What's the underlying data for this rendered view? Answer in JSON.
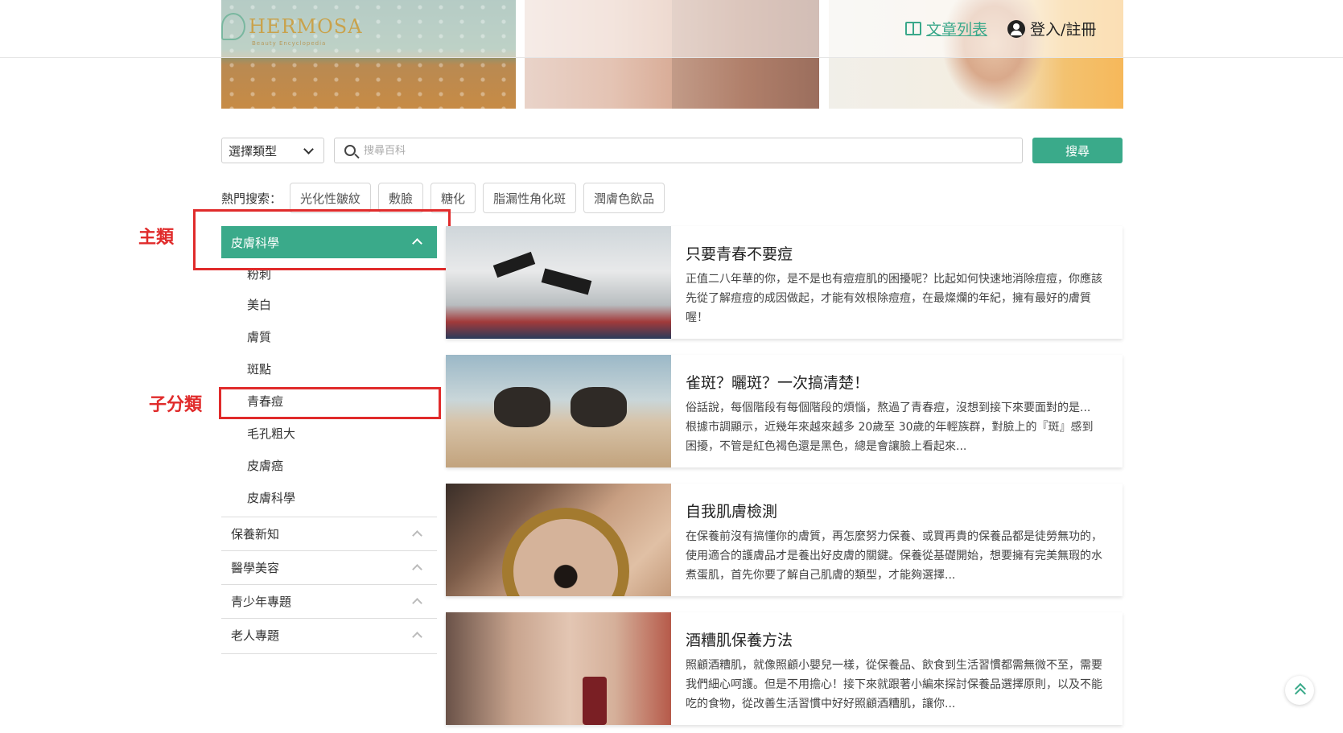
{
  "header": {
    "logo_text": "HERMOSA",
    "logo_sub": "Beauty Encyclopedia",
    "article_list_label": "文章列表",
    "login_label": "登入/註冊"
  },
  "search": {
    "type_select_value": "選擇類型",
    "placeholder": "搜尋百科",
    "button_label": "搜尋"
  },
  "hot_search": {
    "label": "熱門搜索：",
    "tags": [
      "光化性皺紋",
      "敷臉",
      "糖化",
      "脂漏性角化斑",
      "潤膚色飲品"
    ]
  },
  "annotations": {
    "main_category": "主類",
    "sub_category": "子分類"
  },
  "sidebar": {
    "active_category": "皮膚科學",
    "subitems": [
      "粉刺",
      "美白",
      "膚質",
      "斑點",
      "青春痘",
      "毛孔粗大",
      "皮膚癌",
      "皮膚科學"
    ],
    "categories": [
      "保養新知",
      "醫學美容",
      "青少年專題",
      "老人專題"
    ]
  },
  "articles": [
    {
      "title": "只要青春不要痘",
      "desc": "正值二八年華的你，是不是也有痘痘肌的困擾呢？比起如何快速地消除痘痘，你應該先從了解痘痘的成因做起，才能有效根除痘痘，在最燦爛的年紀，擁有最好的膚質喔！"
    },
    {
      "title": "雀斑？曬斑？一次搞清楚！",
      "desc": "俗話說，每個階段有每個階段的煩惱，熬過了青春痘，沒想到接下來要面對的是... 根據市調顯示，近幾年來越來越多 20歲至 30歲的年輕族群，對臉上的『斑』感到困擾，不管是紅色褐色還是黑色，總是會讓臉上看起來..."
    },
    {
      "title": "自我肌膚檢測",
      "desc": "在保養前沒有搞懂你的膚質，再怎麼努力保養、或買再貴的保養品都是徒勞無功的，使用適合的護膚品才是養出好皮膚的關鍵。保養從基礎開始，想要擁有完美無瑕的水煮蛋肌，首先你要了解自己肌膚的類型，才能夠選擇..."
    },
    {
      "title": "酒糟肌保養方法",
      "desc": "照顧酒糟肌，就像照顧小嬰兒一樣，從保養品、飲食到生活習慣都需無微不至，需要我們細心呵護。但是不用擔心！接下來就跟著小編來探討保養品選擇原則，以及不能吃的食物，從改善生活習慣中好好照顧酒糟肌，讓你..."
    }
  ],
  "colors": {
    "accent": "#3aaa8a",
    "annotation_red": "#e02b2b"
  }
}
